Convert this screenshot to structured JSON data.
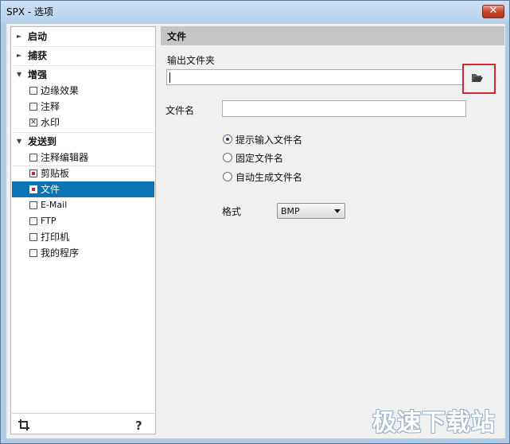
{
  "window": {
    "title": "SPX - 选项",
    "close_glyph": "✕"
  },
  "tree": {
    "items": [
      {
        "label": "启动",
        "type": "group",
        "icon": "arrow-right"
      },
      {
        "label": "捕获",
        "type": "group",
        "icon": "arrow-right"
      },
      {
        "label": "增强",
        "type": "group",
        "icon": "arrow-down"
      },
      {
        "label": "边缘效果",
        "type": "child",
        "state": "unchecked"
      },
      {
        "label": "注释",
        "type": "child",
        "state": "unchecked"
      },
      {
        "label": "水印",
        "type": "child",
        "state": "crossed"
      },
      {
        "label": "发送到",
        "type": "group",
        "icon": "arrow-down"
      },
      {
        "label": "注释编辑器",
        "type": "child",
        "state": "unchecked"
      },
      {
        "label": "剪贴板",
        "type": "child",
        "state": "dot"
      },
      {
        "label": "文件",
        "type": "child",
        "state": "dot",
        "selected": true
      },
      {
        "label": "E-Mail",
        "type": "child",
        "state": "unchecked"
      },
      {
        "label": "FTP",
        "type": "child",
        "state": "unchecked"
      },
      {
        "label": "打印机",
        "type": "child",
        "state": "unchecked"
      },
      {
        "label": "我的程序",
        "type": "child",
        "state": "unchecked"
      }
    ],
    "crossed_glyph": "✕",
    "bottom_help": "?"
  },
  "panel": {
    "title": "文件",
    "output_folder_label": "输出文件夹",
    "output_folder_value": "",
    "file_name_label": "文件名",
    "file_name_value": "",
    "radio_options": [
      {
        "label": "提示输入文件名",
        "checked": true
      },
      {
        "label": "固定文件名",
        "checked": false
      },
      {
        "label": "自动生成文件名",
        "checked": false
      }
    ],
    "format_label": "格式",
    "format_value": "BMP"
  },
  "watermark": "极速下载站",
  "colors": {
    "selection": "#0a74b6",
    "highlight_border": "#d4272e",
    "titlebar": "#b6d0ea"
  }
}
